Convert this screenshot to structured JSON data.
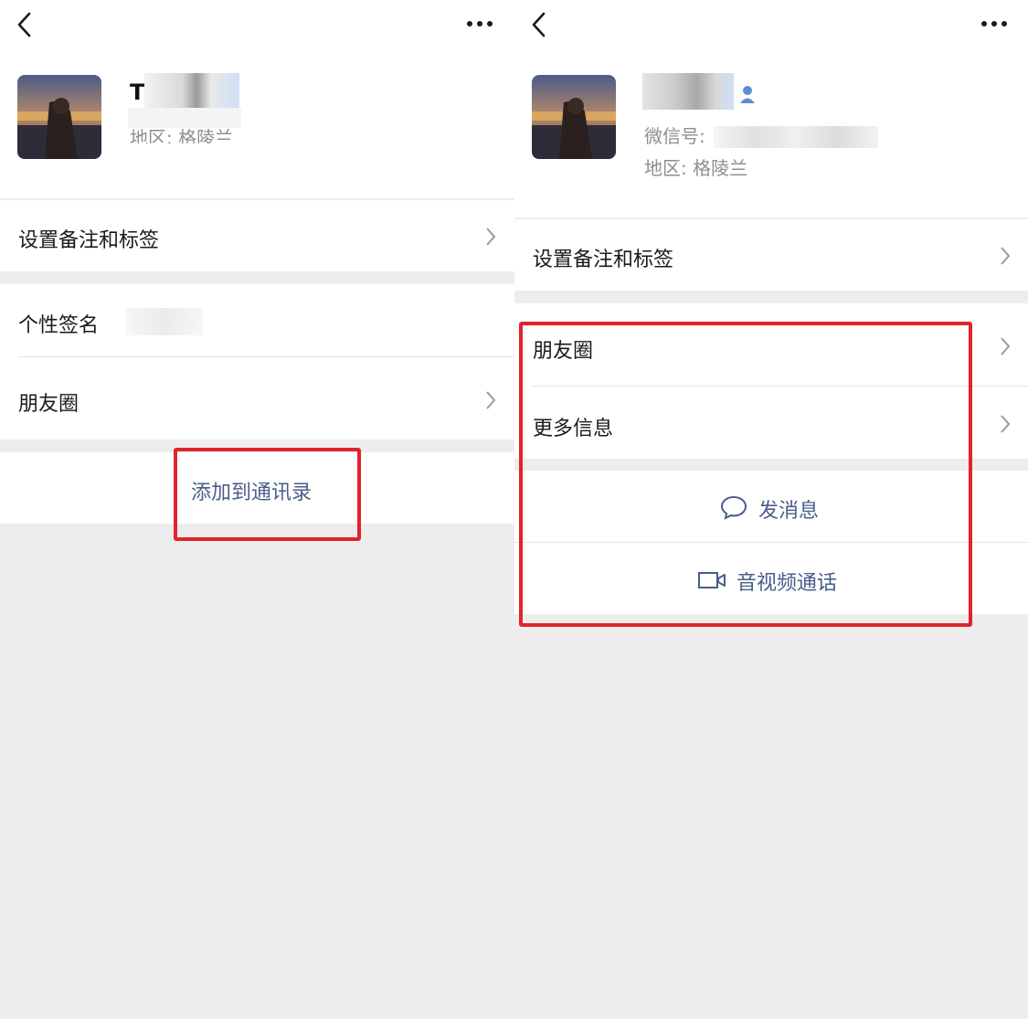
{
  "left": {
    "nickname": "T",
    "region": "地区: 格陵兰",
    "remark_tags": "设置备注和标签",
    "signature_label": "个性签名",
    "moments": "朋友圈",
    "add_contact": "添加到通讯录"
  },
  "right": {
    "wechat_id_label": "微信号:",
    "region": "地区: 格陵兰",
    "remark_tags": "设置备注和标签",
    "moments": "朋友圈",
    "more_info": "更多信息",
    "send_message": "发消息",
    "video_call": "音视频通话"
  },
  "colors": {
    "highlight_box": "#e0242c",
    "action_text": "#4a5d8a",
    "page_bg": "#ededed"
  },
  "icons": [
    "back-arrow-icon",
    "more-dots-icon",
    "chevron-right-icon",
    "chat-bubble-icon",
    "video-camera-icon",
    "avatar-male-icon"
  ]
}
